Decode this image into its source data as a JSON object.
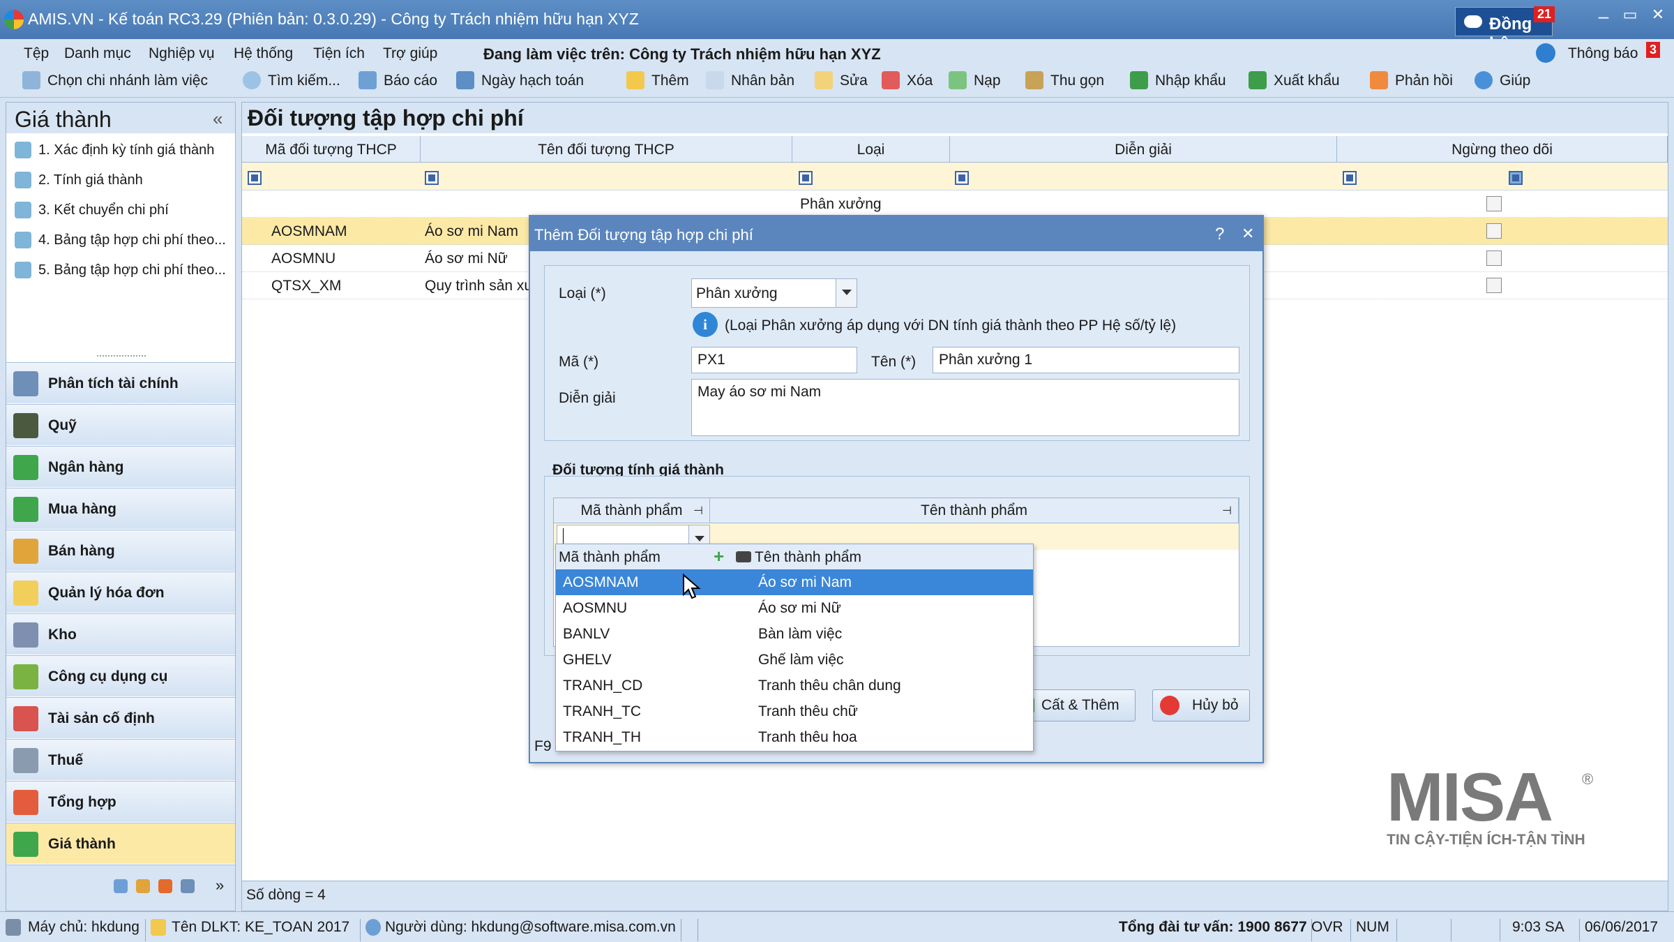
{
  "window": {
    "title": "AMIS.VN - Kế toán RC3.29 (Phiên bản: 0.3.0.29) - Công ty Trách nhiệm hữu hạn XYZ",
    "sync_label": "Đồng bộ",
    "sync_badge": "21",
    "minimize": "–",
    "maximize": "▭",
    "close": "✕"
  },
  "menu": {
    "items": [
      "Tệp",
      "Danh mục",
      "Nghiệp vụ",
      "Hệ thống",
      "Tiện ích",
      "Trợ giúp"
    ],
    "working_on": "Đang làm việc trên: Công ty Trách nhiệm hữu hạn XYZ",
    "notify_label": "Thông báo",
    "notify_badge": "3"
  },
  "toolbar": {
    "items": [
      "Chọn chi nhánh làm việc",
      "Tìm kiếm...",
      "Báo cáo",
      "Ngày hạch toán",
      "Thêm",
      "Nhân bản",
      "Sửa",
      "Xóa",
      "Nạp",
      "Thu gọn",
      "Nhập khẩu",
      "Xuất khẩu",
      "Phản hồi",
      "Giúp"
    ]
  },
  "sidebar": {
    "title": "Giá thành",
    "collapse": "«",
    "tasks": [
      "1. Xác định kỳ tính giá thành",
      "2. Tính giá thành",
      "3. Kết chuyển chi phí",
      "4. Bảng tập hợp chi phí theo...",
      "5. Bảng tập hợp chi phí theo..."
    ],
    "modules": [
      "Phân tích tài chính",
      "Quỹ",
      "Ngân hàng",
      "Mua hàng",
      "Bán hàng",
      "Quản lý hóa đơn",
      "Kho",
      "Công cụ dụng cụ",
      "Tài sản cố định",
      "Thuế",
      "Tổng hợp",
      "Giá thành"
    ],
    "active_module": "Giá thành"
  },
  "main": {
    "title": "Đối tượng tập hợp chi phí",
    "columns": [
      "Mã đối tượng THCP",
      "Tên đối tượng THCP",
      "Loại",
      "Diễn giải",
      "Ngừng theo dõi"
    ],
    "rows": [
      {
        "code": "",
        "name": "",
        "type": "Phân xưởng"
      },
      {
        "code": "AOSMNAM",
        "name": "Áo sơ mi Nam",
        "type": ""
      },
      {
        "code": "AOSMNU",
        "name": "Áo sơ mi Nữ",
        "type": ""
      },
      {
        "code": "QTSX_XM",
        "name": "Quy trình sản xu",
        "type": ""
      }
    ],
    "row_count": "Số dòng = 4"
  },
  "dialog": {
    "title": "Thêm Đối tượng tập hợp chi phí",
    "help": "?",
    "close": "✕",
    "type_label": "Loại (*)",
    "type_value": "Phân xưởng",
    "info": "(Loại Phân xưởng áp dụng với DN tính giá thành theo PP Hệ số/tỷ lệ)",
    "code_label": "Mã (*)",
    "code_value": "PX1",
    "name_label": "Tên (*)",
    "name_value": "Phân xưởng 1",
    "desc_label": "Diễn giải",
    "desc_value": "May áo sơ mi Nam",
    "group_title": "Đối tượng tính giá thành",
    "col_code": "Mã thành phẩm",
    "col_name": "Tên thành phẩm",
    "f9": "F9",
    "save_add": "Cất & Thêm",
    "cancel": "Hủy bỏ"
  },
  "dropdown": {
    "head_code": "Mã thành phẩm",
    "head_name": "Tên thành phẩm",
    "items": [
      {
        "code": "AOSMNAM",
        "name": "Áo sơ mi Nam"
      },
      {
        "code": "AOSMNU",
        "name": "Áo sơ mi Nữ"
      },
      {
        "code": "BANLV",
        "name": "Bàn làm việc"
      },
      {
        "code": "GHELV",
        "name": "Ghế làm việc"
      },
      {
        "code": "TRANH_CD",
        "name": "Tranh thêu chân dung"
      },
      {
        "code": "TRANH_TC",
        "name": "Tranh thêu chữ"
      },
      {
        "code": "TRANH_TH",
        "name": "Tranh thêu hoa"
      }
    ]
  },
  "status": {
    "server": "Máy chủ: hkdung",
    "db": "Tên DLKT: KE_TOAN 2017",
    "user": "Người dùng: hkdung@software.misa.com.vn",
    "hotline": "Tổng đài tư vấn: 1900 8677",
    "ovr": "OVR",
    "num": "NUM",
    "time": "9:03 SA",
    "date": "06/06/2017"
  },
  "brand": {
    "logo_text": "MISA",
    "slogan": "TIN CẬY-TIỆN ÍCH-TẬN TÌNH",
    "reg": "®"
  }
}
